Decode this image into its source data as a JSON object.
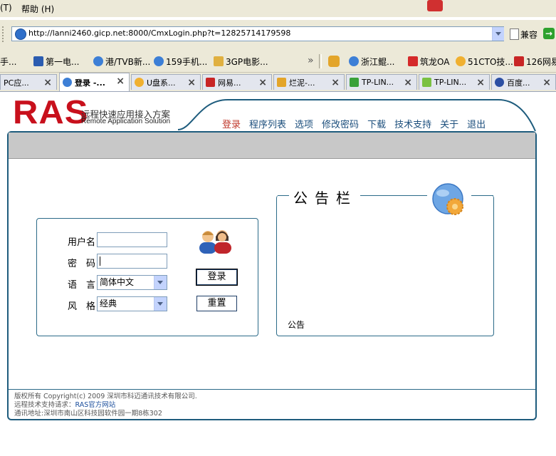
{
  "menu": {
    "tools_tail": "(T)",
    "help": "帮助",
    "help_key": "(H)"
  },
  "address": {
    "url": "http://lanni2460.gicp.net:8000/CmxLogin.php?t=12825714179598",
    "compat": "兼容"
  },
  "favorites": [
    {
      "label": "手...",
      "icon": "page-icon"
    },
    {
      "label": "第一电...",
      "icon": "site-icon"
    },
    {
      "label": "港/TVB新...",
      "icon": "ie-icon"
    },
    {
      "label": "159手机...",
      "icon": "ie-icon"
    },
    {
      "label": "3GP电影...",
      "icon": "folder-icon"
    },
    {
      "label": "浙江鲲...",
      "icon": "ie-icon"
    },
    {
      "label": "筑龙OA",
      "icon": "site-icon"
    },
    {
      "label": "51CTO技...",
      "icon": "bulb-icon"
    },
    {
      "label": "126网易...",
      "icon": "mail-icon"
    }
  ],
  "tabs": [
    {
      "label": "PC应...",
      "active": false
    },
    {
      "label": "登录 -...",
      "active": true
    },
    {
      "label": "U盘系...",
      "active": false
    },
    {
      "label": "网易...",
      "active": false
    },
    {
      "label": "烂泥-...",
      "active": false
    },
    {
      "label": "TP-LIN...",
      "active": false
    },
    {
      "label": "TP-LIN...",
      "active": false
    },
    {
      "label": "百度...",
      "active": false
    }
  ],
  "brand": {
    "logo": "RAS",
    "tagline_cn": "远程快速应用接入方案",
    "tagline_en": "Remote Application Solution"
  },
  "nav": [
    "登录",
    "程序列表",
    "选项",
    "修改密码",
    "下载",
    "技术支持",
    "关于",
    "退出"
  ],
  "login": {
    "username_label": "用户名",
    "password_label": "密　码",
    "language_label": "语　言",
    "style_label": "风　格",
    "language_value": "简体中文",
    "style_value": "经典",
    "login_button": "登录",
    "reset_button": "重置"
  },
  "notice": {
    "title": "公告栏",
    "content": "公告"
  },
  "footer": {
    "copyright": "版权所有 Copyright(c) 2009 深圳市科迈通讯技术有限公司.",
    "support_prefix": "远程技术支持请求：",
    "support_link": "RAS官方网站",
    "address": "通讯地址:深圳市南山区科技园软件园一期8栋302"
  },
  "colors": {
    "brand_red": "#c8101c",
    "frame_blue": "#1e5c7d",
    "nav_blue": "#1b4e7c",
    "active_nav": "#c0392b"
  }
}
